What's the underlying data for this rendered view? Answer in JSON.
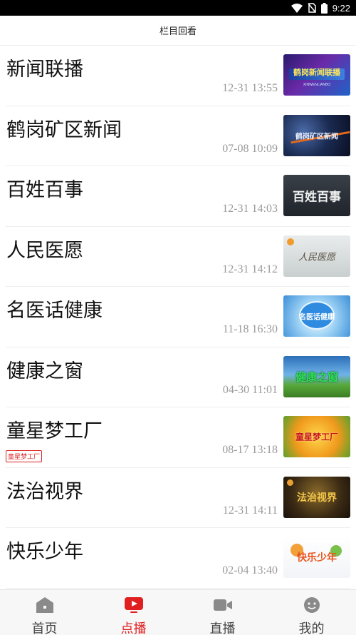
{
  "status_bar": {
    "time": "9:22"
  },
  "header": {
    "title": "栏目回看"
  },
  "programs": [
    {
      "title": "新闻联播",
      "time": "12-31 13:55",
      "thumb_text": "鹤岗新闻联播",
      "thumb_sub": "XINWENLIANBO"
    },
    {
      "title": "鹤岗矿区新闻",
      "time": "07-08 10:09",
      "thumb_text": "鹤岗矿区新闻",
      "thumb_sub": ""
    },
    {
      "title": "百姓百事",
      "time": "12-31 14:03",
      "thumb_text": "百姓百事",
      "thumb_sub": ""
    },
    {
      "title": "人民医愿",
      "time": "12-31 14:12",
      "thumb_text": "人民医愿",
      "thumb_sub": ""
    },
    {
      "title": "名医话健康",
      "time": "11-18 16:30",
      "thumb_text": "名医话健康",
      "thumb_sub": ""
    },
    {
      "title": " 健康之窗",
      "time": "04-30 11:01",
      "thumb_text": "健康之窗",
      "thumb_sub": ""
    },
    {
      "title": "童星梦工厂",
      "time": "08-17 13:18",
      "thumb_text": "童星梦工厂",
      "thumb_sub": "",
      "tag": "童星梦工厂"
    },
    {
      "title": "法治视界",
      "time": "12-31 14:11",
      "thumb_text": "法治视界",
      "thumb_sub": ""
    },
    {
      "title": "快乐少年",
      "time": "02-04 13:40",
      "thumb_text": "快乐少年",
      "thumb_sub": ""
    }
  ],
  "tabs": [
    {
      "label": "首页",
      "icon": "home-icon"
    },
    {
      "label": "点播",
      "icon": "play-icon",
      "active": true
    },
    {
      "label": "直播",
      "icon": "video-camera-icon"
    },
    {
      "label": "我的",
      "icon": "user-face-icon"
    }
  ],
  "colors": {
    "accent": "#e02020",
    "time_text": "#9a9a9a",
    "tab_inactive": "#444444"
  }
}
